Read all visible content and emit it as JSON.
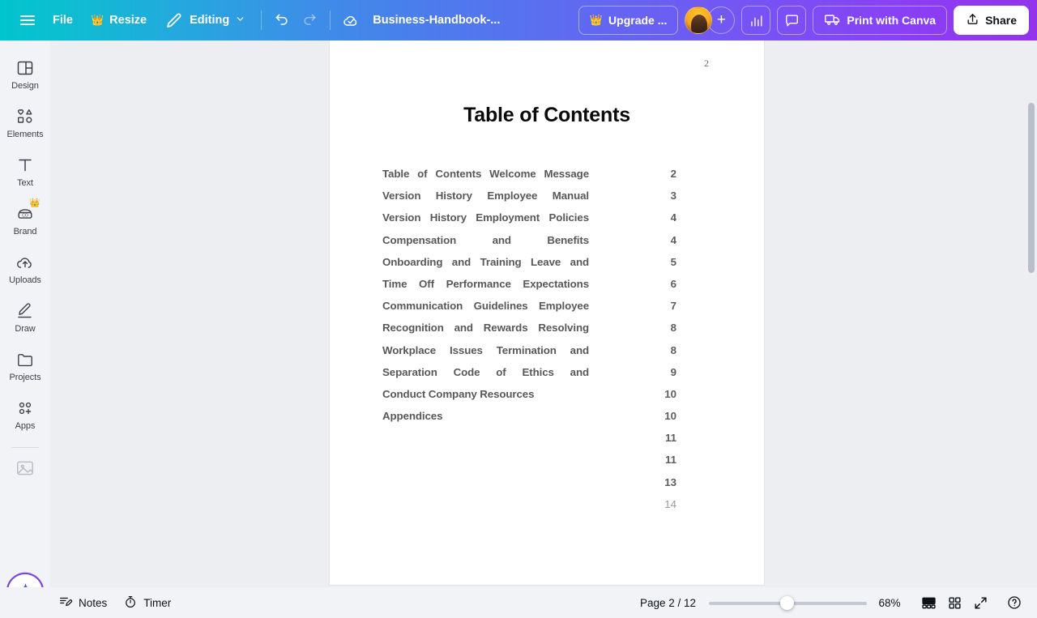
{
  "topbar": {
    "menu_icon": "hamburger-menu-icon",
    "file_label": "File",
    "resize_label": "Resize",
    "resize_icon": "crown-icon",
    "editing_label": "Editing",
    "editing_icon": "pencil-icon",
    "editing_chevron": "chevron-down-icon",
    "undo_icon": "undo-arrow-icon",
    "redo_icon": "redo-arrow-icon",
    "cloud_saved_icon": "cloud-check-icon",
    "doc_title": "Business-Handbook-...",
    "upgrade_label": "Upgrade ...",
    "upgrade_icon": "crown-icon",
    "avatar_name": "user-avatar",
    "add_member_label": "+",
    "insights_icon": "bar-chart-icon",
    "comment_icon": "speech-bubble-icon",
    "print_label": "Print with Canva",
    "print_icon": "delivery-truck-icon",
    "share_label": "Share",
    "share_icon": "share-upload-icon"
  },
  "rail": {
    "items": [
      {
        "label": "Design",
        "icon": "layout-panel-icon",
        "premium": false
      },
      {
        "label": "Elements",
        "icon": "shapes-icon",
        "premium": false
      },
      {
        "label": "Text",
        "icon": "text-t-icon",
        "premium": false
      },
      {
        "label": "Brand",
        "icon": "brand-kit-icon",
        "premium": true
      },
      {
        "label": "Uploads",
        "icon": "cloud-upload-icon",
        "premium": false
      },
      {
        "label": "Draw",
        "icon": "pen-draw-icon",
        "premium": false
      },
      {
        "label": "Projects",
        "icon": "folder-icon",
        "premium": false
      },
      {
        "label": "Apps",
        "icon": "apps-grid-plus-icon",
        "premium": false
      }
    ],
    "thumbnail_icon": "image-placeholder-icon",
    "magic_icon": "magic-sparkle-icon"
  },
  "document": {
    "page_number_header": "2",
    "title": "Table of Contents",
    "entries": [
      {
        "text": "Table of Contents Welcome Message",
        "page": "2"
      },
      {
        "text": "Version History Employee Manual",
        "page": "3"
      },
      {
        "text": "Version History Employment Policies",
        "page": "4"
      },
      {
        "text": "Compensation and Benefits",
        "page": "4"
      },
      {
        "text": "Onboarding and Training Leave and",
        "page": "5"
      },
      {
        "text": "Time Off Performance Expectations",
        "page": "6"
      },
      {
        "text": "Communication Guidelines Employee",
        "page": "7"
      },
      {
        "text": "Recognition and Rewards Resolving",
        "page": "8"
      },
      {
        "text": "Workplace Issues Termination and",
        "page": "8"
      },
      {
        "text": "Separation Code of Ethics and",
        "page": "9"
      },
      {
        "text": "Conduct Company Resources",
        "page": "10"
      },
      {
        "text": "Appendices",
        "page": "10"
      },
      {
        "text": "",
        "page": "11"
      },
      {
        "text": "",
        "page": "11"
      },
      {
        "text": "",
        "page": "13"
      },
      {
        "text": "",
        "page": "14"
      }
    ]
  },
  "bottombar": {
    "notes_label": "Notes",
    "notes_icon": "notes-pencil-icon",
    "timer_label": "Timer",
    "timer_icon": "stopwatch-icon",
    "page_indicator": "Page 2 / 12",
    "zoom_level": "68%",
    "presenter_icon": "presenter-view-icon",
    "grid_icon": "grid-view-icon",
    "fullscreen_icon": "expand-fullscreen-icon",
    "help_icon": "help-question-icon"
  },
  "colors": {
    "gradient_start": "#00c4cc",
    "gradient_mid": "#5a6ff0",
    "gradient_end": "#9333ea",
    "rail_bg": "#f2f3f7",
    "canvas_bg": "#edeef2",
    "premium_gold": "#f5a623"
  }
}
